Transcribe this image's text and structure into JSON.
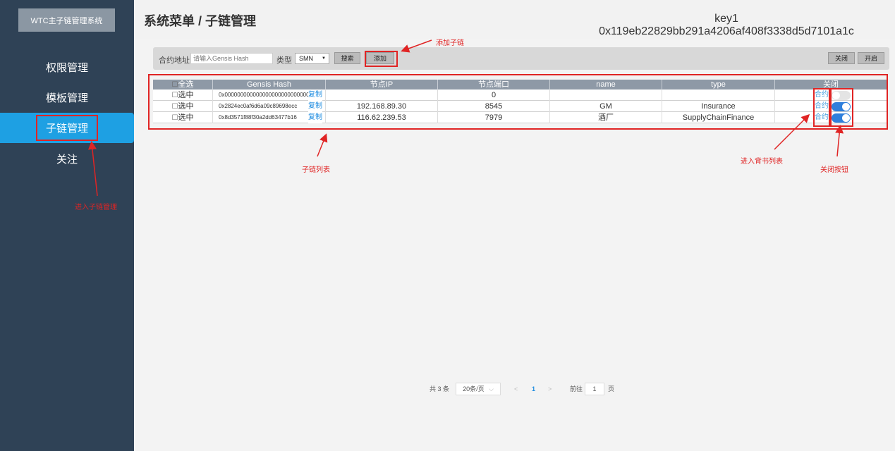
{
  "sidebar": {
    "logo": "WTC主子链管理系统",
    "items": [
      {
        "label": "权限管理"
      },
      {
        "label": "模板管理"
      },
      {
        "label": "子链管理"
      },
      {
        "label": "关注"
      }
    ]
  },
  "header": {
    "title": "系统菜单 / 子链管理",
    "key_label": "key1",
    "key_value": "0x119eb22829bb291a4206af408f3338d5d7101a1c"
  },
  "toolbar": {
    "address_label": "合约地址:",
    "address_placeholder": "请输入Gensis Hash",
    "type_label": "类型",
    "type_selected": "SMN",
    "search_label": "搜索",
    "add_label": "添加",
    "close_label": "关闭",
    "open_label": "开启"
  },
  "table": {
    "select_all_label": "全选",
    "headers": [
      "Gensis Hash",
      "节点IP",
      "节点端口",
      "name",
      "type",
      "关闭"
    ],
    "select_label": "选中",
    "copy_label": "复制",
    "contract_label": "合约",
    "rows": [
      {
        "hash": "0x000000000000000000000000000",
        "ip": "",
        "port": "0",
        "name": "",
        "type": "",
        "enabled": false
      },
      {
        "hash": "0x2824ec0af6d6a09c89698ecc",
        "ip": "192.168.89.30",
        "port": "8545",
        "name": "GM",
        "type": "Insurance",
        "enabled": true
      },
      {
        "hash": "0x8d3571f88f30a2dd63477b16",
        "ip": "116.62.239.53",
        "port": "7979",
        "name": "酒厂",
        "type": "SupplyChainFinance",
        "enabled": true
      }
    ]
  },
  "annotations": {
    "add_subchain": "添加子链",
    "subchain_list": "子链列表",
    "enter_endorse_list": "进入背书列表",
    "close_button": "关闭按钮",
    "enter_subchain_mgmt": "进入子链管理"
  },
  "pagination": {
    "total": "共 3 条",
    "page_size": "20条/页",
    "current_page": "1",
    "goto_label": "前往",
    "goto_value": "1",
    "page_suffix": "页"
  },
  "colors": {
    "sidebar_bg": "#2f4256",
    "active_menu": "#1ea0e3",
    "annotation_red": "#e02424",
    "toggle_on": "#2f7fdc"
  }
}
